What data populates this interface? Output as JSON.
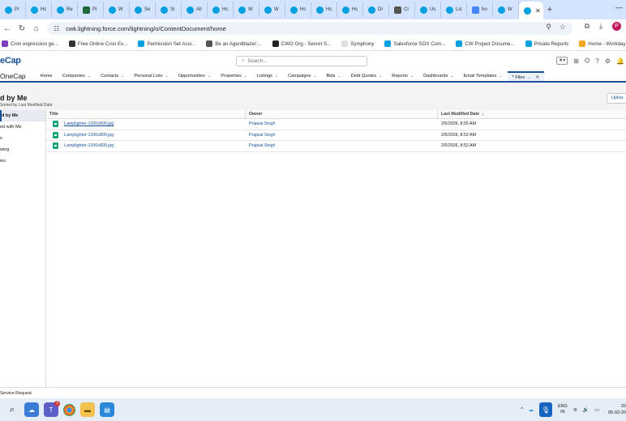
{
  "browser": {
    "tabs": [
      {
        "label": "Pr",
        "icon": "salesforce-cloud",
        "color": "#00a1e0"
      },
      {
        "label": "Hc",
        "icon": "salesforce-cloud",
        "color": "#00a1e0"
      },
      {
        "label": "Re",
        "icon": "salesforce-cloud",
        "color": "#00a1e0"
      },
      {
        "label": "Pr",
        "icon": "green-square",
        "color": "#1e6b3a"
      },
      {
        "label": "W",
        "icon": "salesforce-cloud",
        "color": "#00a1e0"
      },
      {
        "label": "Se",
        "icon": "salesforce-cloud",
        "color": "#00a1e0"
      },
      {
        "label": "Sr",
        "icon": "salesforce-cloud",
        "color": "#00a1e0"
      },
      {
        "label": "All",
        "icon": "salesforce-cloud",
        "color": "#00a1e0"
      },
      {
        "label": "Hc",
        "icon": "salesforce-cloud",
        "color": "#00a1e0"
      },
      {
        "label": "W",
        "icon": "salesforce-cloud",
        "color": "#00a1e0"
      },
      {
        "label": "W",
        "icon": "salesforce-cloud",
        "color": "#00a1e0"
      },
      {
        "label": "Hc",
        "icon": "salesforce-cloud",
        "color": "#00a1e0"
      },
      {
        "label": "Hc",
        "icon": "salesforce-cloud",
        "color": "#00a1e0"
      },
      {
        "label": "Hc",
        "icon": "salesforce-cloud",
        "color": "#00a1e0"
      },
      {
        "label": "Dr",
        "icon": "salesforce-cloud",
        "color": "#00a1e0"
      },
      {
        "label": "Cr",
        "icon": "search-q",
        "color": "#555555"
      },
      {
        "label": "Us",
        "icon": "salesforce-cloud",
        "color": "#00a1e0"
      },
      {
        "label": "Lis",
        "icon": "salesforce-cloud",
        "color": "#00a1e0"
      },
      {
        "label": "ho",
        "icon": "google-g",
        "color": "#4285f4"
      },
      {
        "label": "W",
        "icon": "salesforce-cloud",
        "color": "#00a1e0"
      }
    ],
    "active_tab_icon": "salesforce-cloud",
    "new_tab": "+",
    "minimize": "—",
    "url": "cwk.lightning.force.com/lightning/o/ContentDocument/home"
  },
  "bookmarks": [
    {
      "label": "Cron expression ge...",
      "color": "#7b3fbf"
    },
    {
      "label": "Free Online Cron Ex...",
      "color": "#333333"
    },
    {
      "label": "Permission Set Assi...",
      "color": "#00a1e0"
    },
    {
      "label": "Be an Agentblazer:...",
      "color": "#555555"
    },
    {
      "label": "CWO Org - Secret S...",
      "color": "#222222"
    },
    {
      "label": "Symphony",
      "color": "#e0e0e0"
    },
    {
      "label": "Salesforce SOX Com...",
      "color": "#00a1e0"
    },
    {
      "label": "CW Project Docume...",
      "color": "#00a1e0"
    },
    {
      "label": "Private Reports",
      "color": "#00a1e0"
    },
    {
      "label": "Home - Workday",
      "color": "#f5a623"
    }
  ],
  "salesforce": {
    "logo_text": "eCap",
    "search_placeholder": "Search...",
    "app_name": "OneCap",
    "nav": [
      {
        "label": "Home",
        "chevron": false
      },
      {
        "label": "Companies",
        "chevron": true
      },
      {
        "label": "Contacts",
        "chevron": true
      },
      {
        "label": "Personal Lists",
        "chevron": true
      },
      {
        "label": "Opportunities",
        "chevron": true
      },
      {
        "label": "Properties",
        "chevron": true
      },
      {
        "label": "Listings",
        "chevron": true
      },
      {
        "label": "Campaigns",
        "chevron": true
      },
      {
        "label": "Bids",
        "chevron": true
      },
      {
        "label": "Debt Quotes",
        "chevron": true
      },
      {
        "label": "Reports",
        "chevron": true
      },
      {
        "label": "Dashboards",
        "chevron": true
      },
      {
        "label": "Email Templates",
        "chevron": true
      }
    ],
    "active_nav": {
      "label": "* Files",
      "close": "✕"
    }
  },
  "page": {
    "title": "d by Me",
    "subtitle": "Sorted by Last Modified Date",
    "upload_label": "Uploa",
    "sidebar": [
      {
        "label": "d by Me",
        "active": true
      },
      {
        "label": "ed with Me",
        "active": false
      },
      {
        "label": "s",
        "active": false
      },
      {
        "label": "wing",
        "active": false
      },
      {
        "label": "ies",
        "active": false
      }
    ],
    "columns": {
      "title": "Title",
      "owner": "Owner",
      "date": "Last Modified Date",
      "date_sort_arrow": "↓"
    },
    "rows": [
      {
        "title": "Lamplighter-1200x800.jpg",
        "owner": "Prajwal Singh",
        "date": "2/5/2026, 8:55 AM",
        "underline": true
      },
      {
        "title": "Lamplighter-1200x800.jpg",
        "owner": "Prajwal Singh",
        "date": "2/5/2026, 8:52 AM",
        "underline": false
      },
      {
        "title": "Lamplighter-1200x800.jpg",
        "owner": "Prajwal Singh",
        "date": "2/5/2026, 8:52 AM",
        "underline": false
      }
    ],
    "status_bar": "Service Request"
  },
  "taskbar": {
    "notification_count": "3",
    "lang_line1": "ENG",
    "lang_line2": "IN",
    "time": "20",
    "date": "05-02-20"
  }
}
